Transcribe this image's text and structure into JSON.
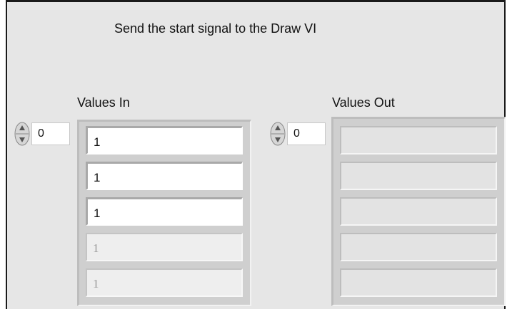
{
  "window": {
    "instruction": "Send the start signal to the Draw VI"
  },
  "values_in": {
    "label": "Values In",
    "index_value": "0",
    "elements": [
      "1",
      "1",
      "1",
      "1",
      "1"
    ]
  },
  "values_out": {
    "label": "Values Out",
    "index_value": "0",
    "elements": [
      "",
      "",
      "",
      "",
      ""
    ]
  },
  "icons": {
    "spinner": "increment-decrement-arrows-icon"
  },
  "colors": {
    "panel_bg": "#e6e6e6",
    "active_cell_bg": "#ffffff",
    "inactive_text": "#9a9a9a"
  }
}
